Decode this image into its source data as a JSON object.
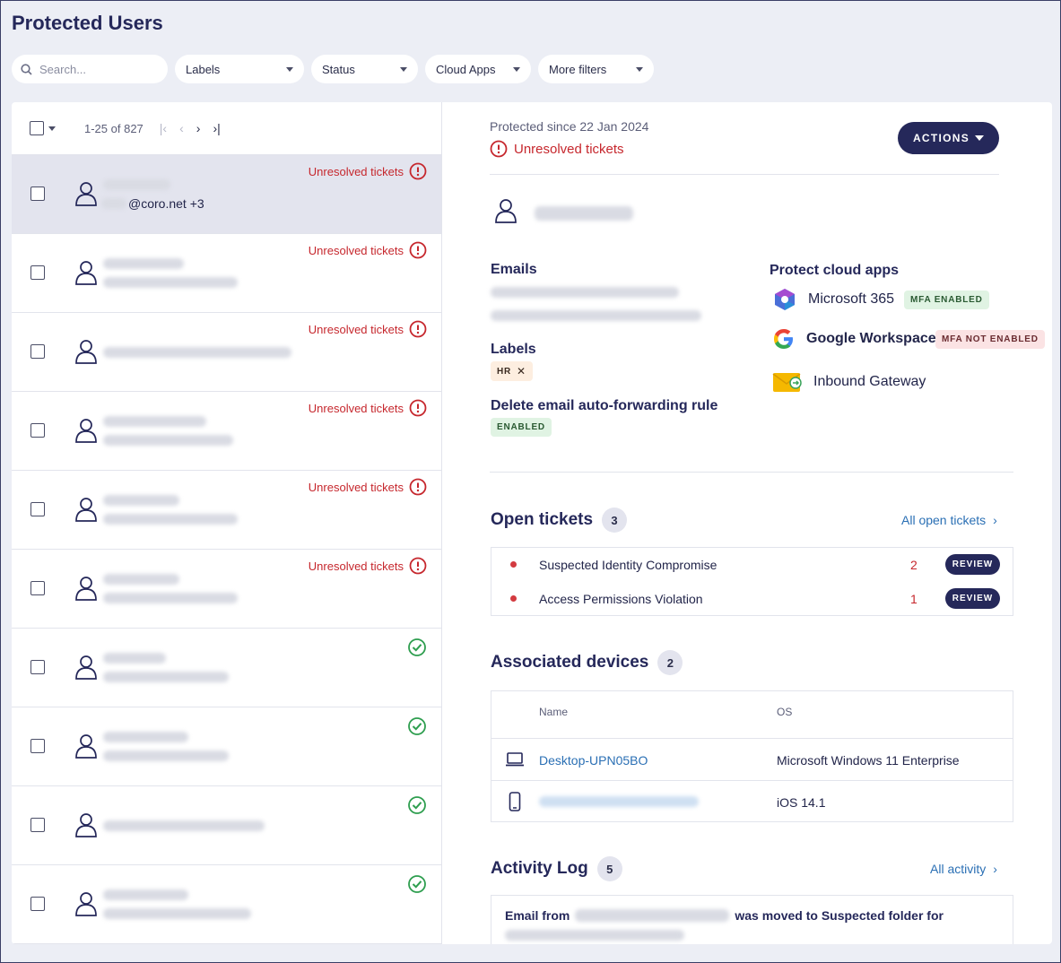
{
  "page": {
    "title": "Protected Users"
  },
  "filters": {
    "search_placeholder": "Search...",
    "labels": "Labels",
    "status": "Status",
    "cloud_apps": "Cloud Apps",
    "more_filters": "More filters"
  },
  "list": {
    "pager": "1-25 of 827",
    "rows": [
      {
        "status": "Unresolved tickets",
        "state": "unresolved",
        "email_suffix": "@coro.net +3"
      },
      {
        "status": "Unresolved tickets",
        "state": "unresolved"
      },
      {
        "status": "Unresolved tickets",
        "state": "unresolved"
      },
      {
        "status": "Unresolved tickets",
        "state": "unresolved"
      },
      {
        "status": "Unresolved tickets",
        "state": "unresolved"
      },
      {
        "status": "Unresolved tickets",
        "state": "unresolved"
      },
      {
        "state": "ok"
      },
      {
        "state": "ok"
      },
      {
        "state": "ok"
      },
      {
        "state": "ok"
      }
    ]
  },
  "detail": {
    "protected_since": "Protected since 22 Jan 2024",
    "unresolved": "Unresolved tickets",
    "actions_label": "ACTIONS",
    "emails_label": "Emails",
    "labels_label": "Labels",
    "label_chip": "HR",
    "delete_rule_label": "Delete email auto-forwarding rule",
    "delete_rule_chip": "ENABLED",
    "cloud_apps_label": "Protect cloud apps",
    "apps": [
      {
        "name": "Microsoft 365",
        "chip": "MFA ENABLED",
        "icon": "microsoft-365-icon"
      },
      {
        "name": "Google Workspace",
        "chip": "MFA NOT ENABLED",
        "icon": "google-icon"
      },
      {
        "name": "Inbound Gateway",
        "icon": "inbound-gateway-icon"
      }
    ]
  },
  "open_tickets": {
    "title": "Open tickets",
    "count": "3",
    "link": "All open tickets",
    "items": [
      {
        "name": "Suspected Identity Compromise",
        "count": "2",
        "action": "REVIEW"
      },
      {
        "name": "Access Permissions Violation",
        "count": "1",
        "action": "REVIEW"
      }
    ]
  },
  "devices": {
    "title": "Associated devices",
    "count": "2",
    "col_name": "Name",
    "col_os": "OS",
    "items": [
      {
        "name": "Desktop-UPN05BO",
        "os": "Microsoft Windows 11 Enterprise",
        "icon": "laptop-icon"
      },
      {
        "name": "",
        "os": "iOS 14.1",
        "icon": "phone-icon"
      }
    ]
  },
  "activity": {
    "title": "Activity Log",
    "count": "5",
    "link": "All activity",
    "entry_prefix": "Email from",
    "entry_suffix": "was moved to Suspected folder for"
  },
  "colors": {
    "accent": "#25285a",
    "alert": "#c6272d",
    "success": "#2e9e4f",
    "link": "#2a6fb4"
  }
}
